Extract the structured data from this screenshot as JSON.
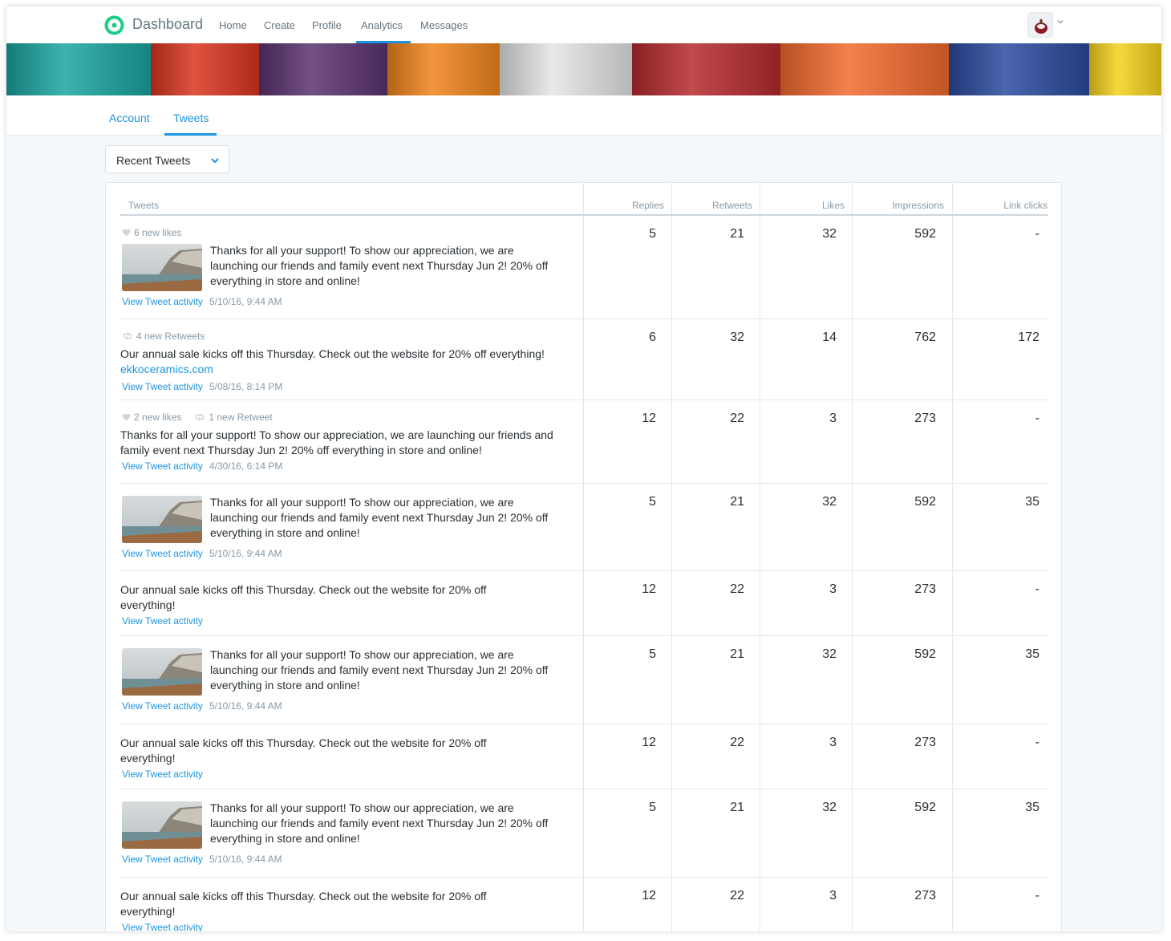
{
  "nav": {
    "brand": "Dashboard",
    "links": [
      "Home",
      "Create",
      "Profile",
      "Analytics",
      "Messages"
    ],
    "active": "Analytics",
    "accent": "#1b95e0"
  },
  "subtabs": {
    "items": [
      "Account",
      "Tweets"
    ],
    "active": "Tweets"
  },
  "filter": {
    "selected": "Recent Tweets"
  },
  "table": {
    "headers": [
      "Tweets",
      "Replies",
      "Retweets",
      "Likes",
      "Impressions",
      "Link clicks"
    ],
    "activity_label": "View Tweet activity",
    "rows": [
      {
        "meta": [
          {
            "icon": "heart-icon",
            "text": "6 new likes"
          }
        ],
        "image": true,
        "text": "Thanks for all your support! To show our appreciation, we are launching our friends and family event next Thursday Jun 2! 20% off everything in store and online!",
        "link": "",
        "date": "5/10/16, 9:44 AM",
        "stats": [
          "5",
          "21",
          "32",
          "592",
          "-"
        ]
      },
      {
        "meta": [
          {
            "icon": "retweet-icon",
            "text": "4 new Retweets"
          }
        ],
        "image": false,
        "text": "Our annual sale kicks off this Thursday. Check out the website for 20% off everything!",
        "link": "ekkoceramics.com",
        "date": "5/08/16, 8:14 PM",
        "stats": [
          "6",
          "32",
          "14",
          "762",
          "172"
        ]
      },
      {
        "meta": [
          {
            "icon": "heart-icon",
            "text": "2 new likes"
          },
          {
            "icon": "retweet-icon",
            "text": "1 new Retweet"
          }
        ],
        "image": false,
        "text": "Thanks for all your support! To show our appreciation, we are launching our friends and family event next Thursday Jun 2! 20% off everything in store and online!",
        "link": "",
        "date": "4/30/16, 6:14 PM",
        "stats": [
          "12",
          "22",
          "3",
          "273",
          "-"
        ]
      },
      {
        "meta": [],
        "image": true,
        "text": "Thanks for all your support! To show our appreciation, we are launching our friends and family event next Thursday Jun 2! 20% off everything in store and online!",
        "link": "",
        "date": "5/10/16, 9:44 AM",
        "stats": [
          "5",
          "21",
          "32",
          "592",
          "35"
        ]
      },
      {
        "meta": [],
        "image": false,
        "text": "Our annual sale kicks off this Thursday. Check out the website for 20% off everything!",
        "link": "",
        "date": "",
        "stats": [
          "12",
          "22",
          "3",
          "273",
          "-"
        ]
      },
      {
        "meta": [],
        "image": true,
        "text": "Thanks for all your support! To show our appreciation, we are launching our friends and family event next Thursday Jun 2! 20% off everything in store and online!",
        "link": "",
        "date": "5/10/16, 9:44 AM",
        "stats": [
          "5",
          "21",
          "32",
          "592",
          "35"
        ]
      },
      {
        "meta": [],
        "image": false,
        "text": "Our annual sale kicks off this Thursday. Check out the website for 20% off everything!",
        "link": "",
        "date": "",
        "stats": [
          "12",
          "22",
          "3",
          "273",
          "-"
        ]
      },
      {
        "meta": [],
        "image": true,
        "text": "Thanks for all your support! To show our appreciation, we are launching our friends and family event next Thursday Jun 2! 20% off everything in store and online!",
        "link": "",
        "date": "5/10/16, 9:44 AM",
        "stats": [
          "5",
          "21",
          "32",
          "592",
          "35"
        ]
      },
      {
        "meta": [],
        "image": false,
        "text": "Our annual sale kicks off this Thursday. Check out the website for 20% off everything!",
        "link": "",
        "date": "",
        "stats": [
          "12",
          "22",
          "3",
          "273",
          "-"
        ]
      }
    ]
  }
}
